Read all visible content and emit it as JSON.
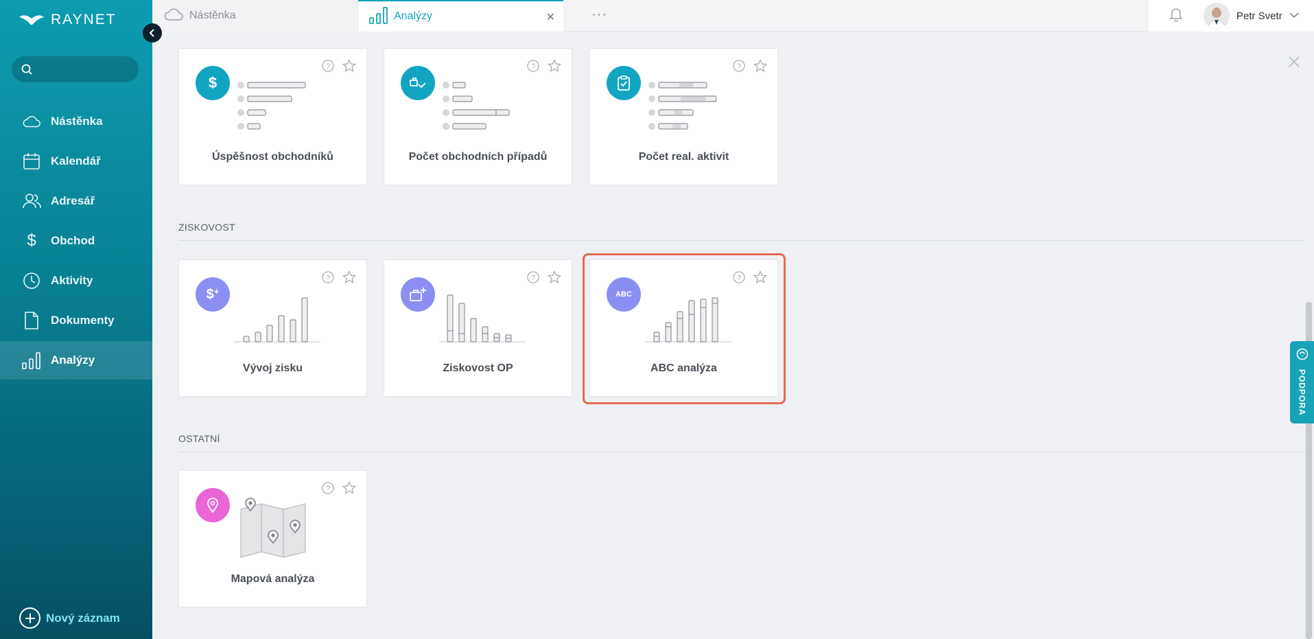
{
  "app": {
    "logo_text": "RAYNET"
  },
  "sidebar": {
    "search": {
      "placeholder": ""
    },
    "items": [
      {
        "label": "Nástěnka",
        "icon": "cloud-icon"
      },
      {
        "label": "Kalendář",
        "icon": "calendar-icon"
      },
      {
        "label": "Adresář",
        "icon": "contacts-icon"
      },
      {
        "label": "Obchod",
        "icon": "dollar-icon"
      },
      {
        "label": "Aktivity",
        "icon": "clock-icon"
      },
      {
        "label": "Dokumenty",
        "icon": "document-icon"
      },
      {
        "label": "Analýzy",
        "icon": "bar-chart-icon",
        "active": true
      }
    ],
    "new_record": "Nový záznam"
  },
  "tabs": [
    {
      "label": "Nástěnka",
      "icon": "cloud-icon"
    },
    {
      "label": "Analýzy",
      "icon": "bar-chart-icon",
      "active": true
    }
  ],
  "more": "···",
  "user": {
    "name": "Petr Svetr"
  },
  "sections": [
    {
      "title": "ZISKOVOST"
    },
    {
      "title": "OSTATNÍ"
    }
  ],
  "cards": {
    "uspesnost": {
      "label": "Úspěšnost obchodníků",
      "icon": "dollar-icon",
      "color": "#11a5c1"
    },
    "pocet_op": {
      "label": "Počet obchodních případů",
      "icon": "handshake-icon",
      "color": "#11a5c1"
    },
    "pocet_akt": {
      "label": "Počet real. aktivit",
      "icon": "clipboard-check-icon",
      "color": "#11a5c1"
    },
    "vyvoj": {
      "label": "Vývoj zisku",
      "icon": "dollar-plus-icon",
      "color": "#8c8ff2"
    },
    "ziskovost_op": {
      "label": "Ziskovost OP",
      "icon": "briefcase-plus-icon",
      "color": "#8c8ff2"
    },
    "abc": {
      "label": "ABC analýza",
      "icon_text": "ABC",
      "color": "#8c8ff2"
    },
    "mapa": {
      "label": "Mapová analýza",
      "icon": "map-pin-icon",
      "color": "#e866d6"
    }
  },
  "support": {
    "label": "PODPORA"
  },
  "colors": {
    "accent": "#17a3b8",
    "highlight": "#e46b53"
  }
}
